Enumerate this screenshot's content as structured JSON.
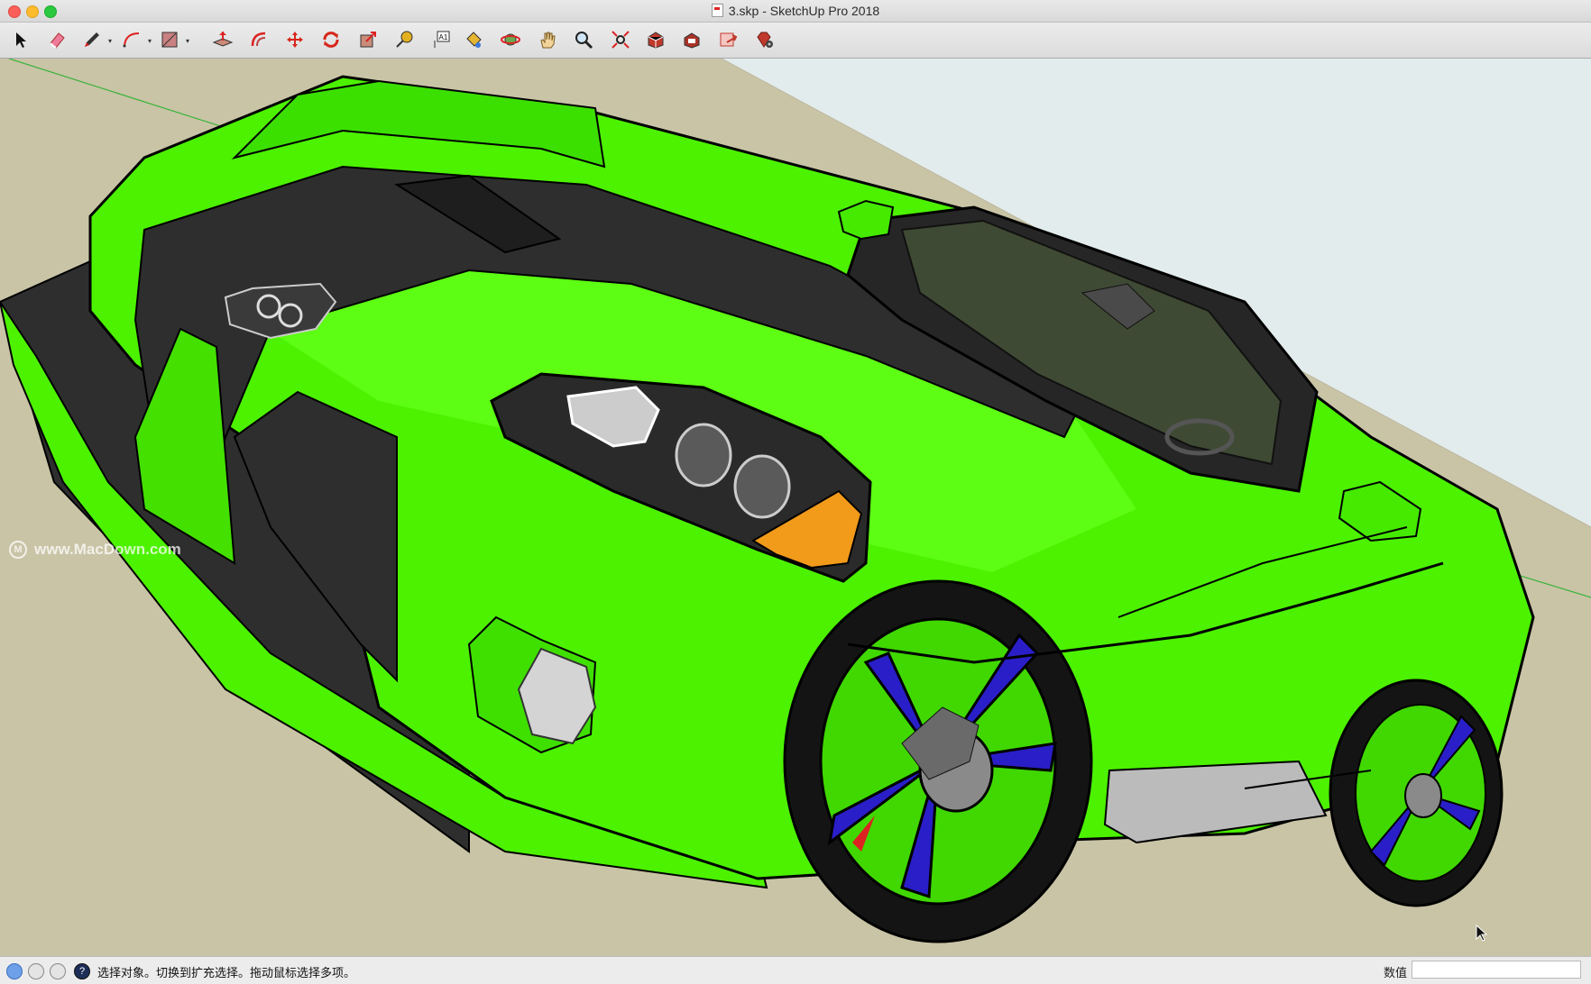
{
  "window": {
    "title": "3.skp - SketchUp Pro 2018"
  },
  "toolbar": {
    "tools": [
      {
        "name": "select-tool",
        "icon": "arrow-cursor-icon"
      },
      {
        "name": "eraser-tool",
        "icon": "eraser-icon"
      },
      {
        "name": "line-tool",
        "icon": "pencil-icon"
      },
      {
        "name": "arc-tool",
        "icon": "arc-icon"
      },
      {
        "name": "shape-tool",
        "icon": "rectangle-icon"
      },
      {
        "name": "push-pull-tool",
        "icon": "push-pull-icon"
      },
      {
        "name": "offset-tool",
        "icon": "offset-icon"
      },
      {
        "name": "move-tool",
        "icon": "move-arrows-icon"
      },
      {
        "name": "rotate-tool",
        "icon": "rotate-icon"
      },
      {
        "name": "scale-tool",
        "icon": "scale-icon"
      },
      {
        "name": "tape-measure-tool",
        "icon": "tape-measure-icon"
      },
      {
        "name": "text-tool",
        "icon": "text-icon"
      },
      {
        "name": "paint-bucket-tool",
        "icon": "paint-bucket-icon"
      },
      {
        "name": "orbit-tool",
        "icon": "orbit-icon"
      },
      {
        "name": "pan-tool",
        "icon": "hand-icon"
      },
      {
        "name": "zoom-tool",
        "icon": "magnifier-icon"
      },
      {
        "name": "zoom-extents-tool",
        "icon": "zoom-extents-icon"
      },
      {
        "name": "warehouse-tool",
        "icon": "3d-warehouse-icon"
      },
      {
        "name": "extension-warehouse-tool",
        "icon": "extension-warehouse-icon"
      },
      {
        "name": "send-to-layout-tool",
        "icon": "layout-icon"
      },
      {
        "name": "extension-manager-tool",
        "icon": "ruby-gem-icon"
      }
    ],
    "text_tool_glyph": "A1"
  },
  "viewport": {
    "watermark": "www.MacDown.com",
    "colors": {
      "ground": "#c9c4a6",
      "sky": "#e6eeee",
      "car_body": "#4cf200",
      "car_dark": "#2e2e2e",
      "rim": "#2a1ec8",
      "indicator": "#f29a1a"
    }
  },
  "statusbar": {
    "message": "选择对象。切换到扩充选择。拖动鼠标选择多项。",
    "measurements_label": "数值",
    "measurements_value": ""
  }
}
